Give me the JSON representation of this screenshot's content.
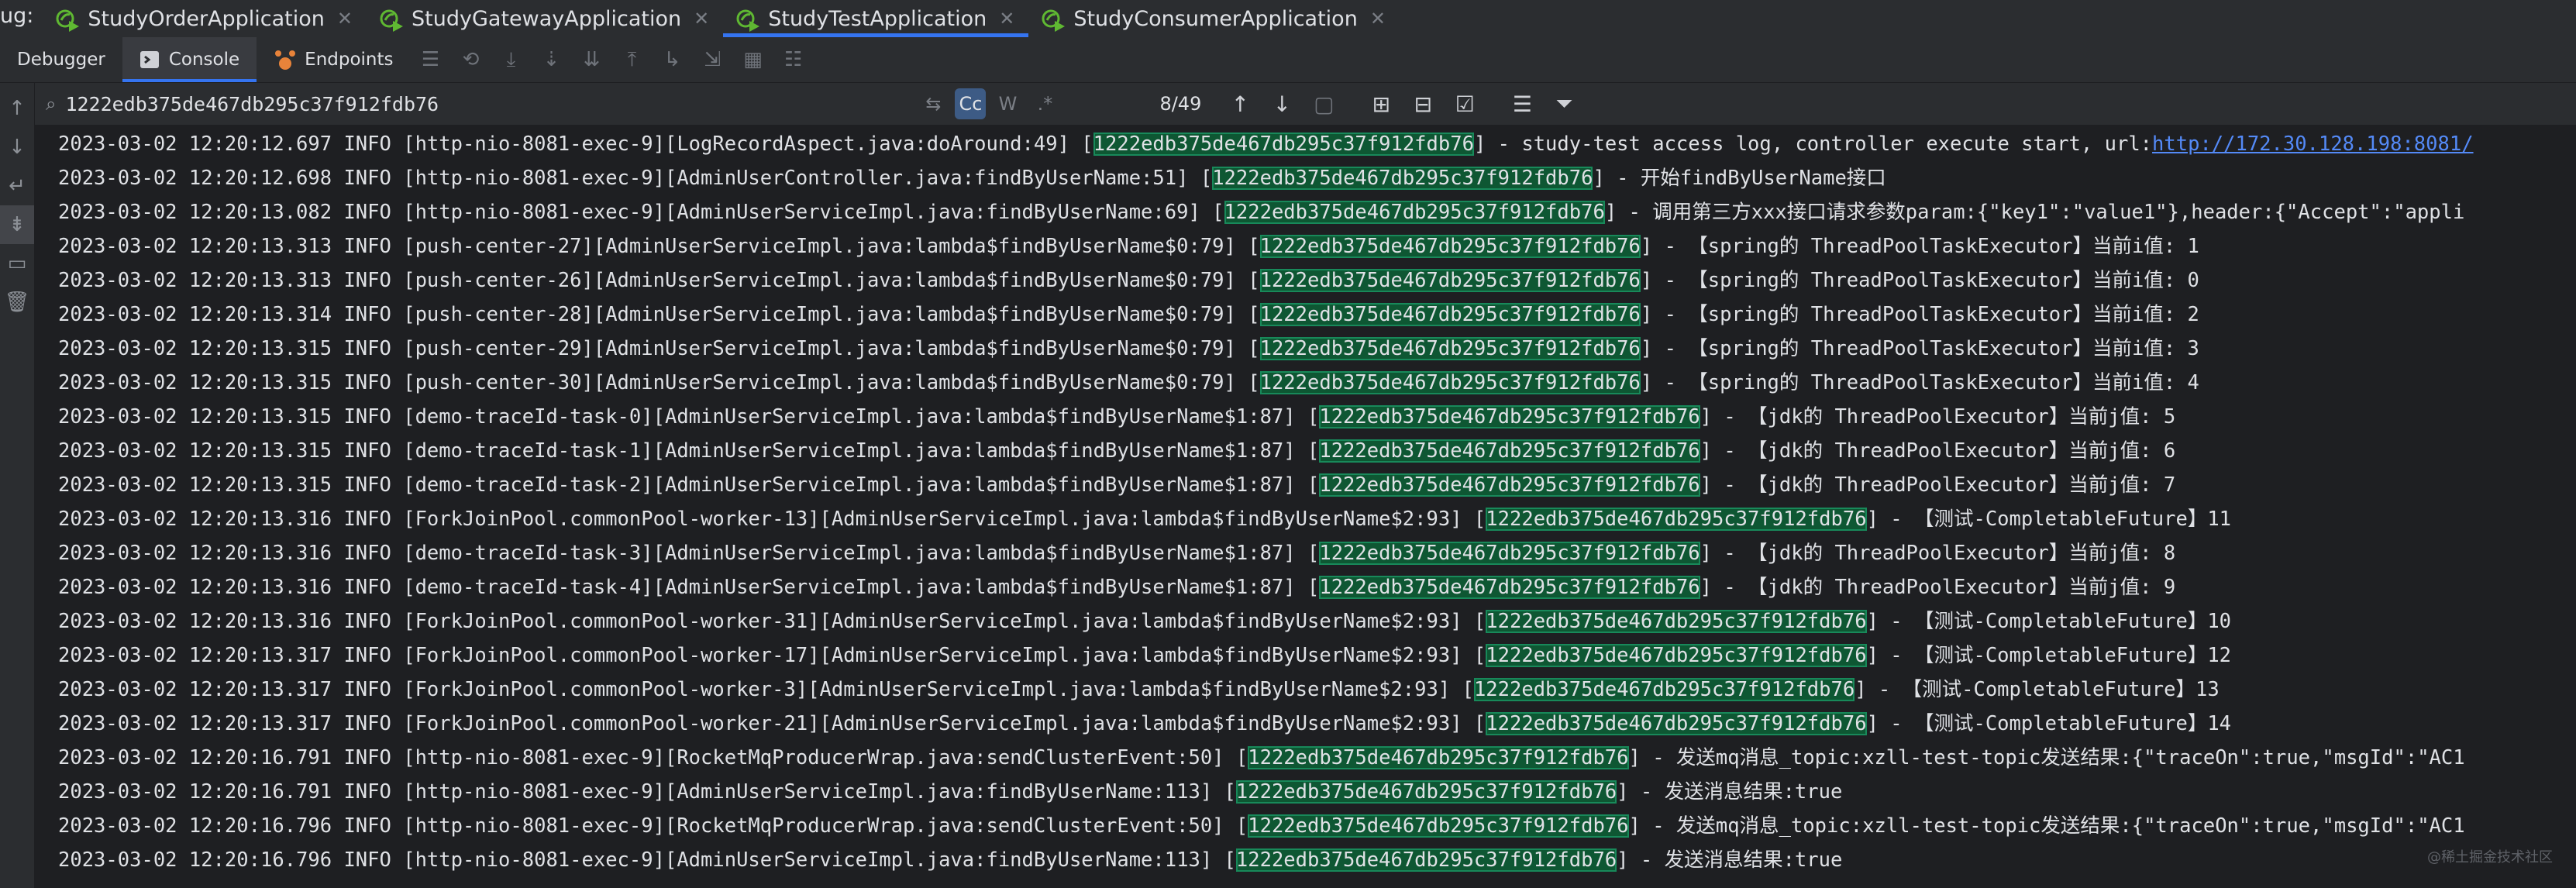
{
  "run_tabs": {
    "prefix": "ug:",
    "items": [
      {
        "label": "StudyOrderApplication",
        "active": false
      },
      {
        "label": "StudyGatewayApplication",
        "active": false
      },
      {
        "label": "StudyTestApplication",
        "active": true
      },
      {
        "label": "StudyConsumerApplication",
        "active": false
      }
    ]
  },
  "toolbar": {
    "debugger_label": "Debugger",
    "console_label": "Console",
    "endpoints_label": "Endpoints"
  },
  "find": {
    "query": "1222edb375de467db295c37f912fdb76",
    "case_label": "Cc",
    "words_label": "W",
    "regex_label": ".*",
    "match_count": "8/49"
  },
  "console_lines": [
    {
      "before": "2023-03-02 12:20:12.697 INFO [http-nio-8081-exec-9][LogRecordAspect.java:doAround:49] [",
      "trace": "1222edb375de467db295c37f912fdb76",
      "after": "] - study-test access log, controller execute start, url:",
      "link": "http://172.30.128.198:8081/"
    },
    {
      "before": "2023-03-02 12:20:12.698 INFO [http-nio-8081-exec-9][AdminUserController.java:findByUserName:51] [",
      "trace": "1222edb375de467db295c37f912fdb76",
      "after": "] - 开始findByUserName接口",
      "link": ""
    },
    {
      "before": "2023-03-02 12:20:13.082 INFO [http-nio-8081-exec-9][AdminUserServiceImpl.java:findByUserName:69] [",
      "trace": "1222edb375de467db295c37f912fdb76",
      "after": "] - 调用第三方xxx接口请求参数param:{\"key1\":\"value1\"},header:{\"Accept\":\"appli",
      "link": ""
    },
    {
      "before": "2023-03-02 12:20:13.313 INFO [push-center-27][AdminUserServiceImpl.java:lambda$findByUserName$0:79] [",
      "trace": "1222edb375de467db295c37f912fdb76",
      "after": "] - 【spring的 ThreadPoolTaskExecutor】当前i值: 1",
      "link": ""
    },
    {
      "before": "2023-03-02 12:20:13.313 INFO [push-center-26][AdminUserServiceImpl.java:lambda$findByUserName$0:79] [",
      "trace": "1222edb375de467db295c37f912fdb76",
      "after": "] - 【spring的 ThreadPoolTaskExecutor】当前i值: 0",
      "link": ""
    },
    {
      "before": "2023-03-02 12:20:13.314 INFO [push-center-28][AdminUserServiceImpl.java:lambda$findByUserName$0:79] [",
      "trace": "1222edb375de467db295c37f912fdb76",
      "after": "] - 【spring的 ThreadPoolTaskExecutor】当前i值: 2",
      "link": ""
    },
    {
      "before": "2023-03-02 12:20:13.315 INFO [push-center-29][AdminUserServiceImpl.java:lambda$findByUserName$0:79] [",
      "trace": "1222edb375de467db295c37f912fdb76",
      "after": "] - 【spring的 ThreadPoolTaskExecutor】当前i值: 3",
      "link": ""
    },
    {
      "before": "2023-03-02 12:20:13.315 INFO [push-center-30][AdminUserServiceImpl.java:lambda$findByUserName$0:79] [",
      "trace": "1222edb375de467db295c37f912fdb76",
      "after": "] - 【spring的 ThreadPoolTaskExecutor】当前i值: 4",
      "link": ""
    },
    {
      "before": "2023-03-02 12:20:13.315 INFO [demo-traceId-task-0][AdminUserServiceImpl.java:lambda$findByUserName$1:87] [",
      "trace": "1222edb375de467db295c37f912fdb76",
      "after": "] - 【jdk的 ThreadPoolExecutor】当前j值: 5",
      "link": ""
    },
    {
      "before": "2023-03-02 12:20:13.315 INFO [demo-traceId-task-1][AdminUserServiceImpl.java:lambda$findByUserName$1:87] [",
      "trace": "1222edb375de467db295c37f912fdb76",
      "after": "] - 【jdk的 ThreadPoolExecutor】当前j值: 6",
      "link": ""
    },
    {
      "before": "2023-03-02 12:20:13.315 INFO [demo-traceId-task-2][AdminUserServiceImpl.java:lambda$findByUserName$1:87] [",
      "trace": "1222edb375de467db295c37f912fdb76",
      "after": "] - 【jdk的 ThreadPoolExecutor】当前j值: 7",
      "link": ""
    },
    {
      "before": "2023-03-02 12:20:13.316 INFO [ForkJoinPool.commonPool-worker-13][AdminUserServiceImpl.java:lambda$findByUserName$2:93] [",
      "trace": "1222edb375de467db295c37f912fdb76",
      "after": "] - 【测试-CompletableFuture】11",
      "link": ""
    },
    {
      "before": "2023-03-02 12:20:13.316 INFO [demo-traceId-task-3][AdminUserServiceImpl.java:lambda$findByUserName$1:87] [",
      "trace": "1222edb375de467db295c37f912fdb76",
      "after": "] - 【jdk的 ThreadPoolExecutor】当前j值: 8",
      "link": ""
    },
    {
      "before": "2023-03-02 12:20:13.316 INFO [demo-traceId-task-4][AdminUserServiceImpl.java:lambda$findByUserName$1:87] [",
      "trace": "1222edb375de467db295c37f912fdb76",
      "after": "] - 【jdk的 ThreadPoolExecutor】当前j值: 9",
      "link": ""
    },
    {
      "before": "2023-03-02 12:20:13.316 INFO [ForkJoinPool.commonPool-worker-31][AdminUserServiceImpl.java:lambda$findByUserName$2:93] [",
      "trace": "1222edb375de467db295c37f912fdb76",
      "after": "] - 【测试-CompletableFuture】10",
      "link": ""
    },
    {
      "before": "2023-03-02 12:20:13.317 INFO [ForkJoinPool.commonPool-worker-17][AdminUserServiceImpl.java:lambda$findByUserName$2:93] [",
      "trace": "1222edb375de467db295c37f912fdb76",
      "after": "] - 【测试-CompletableFuture】12",
      "link": ""
    },
    {
      "before": "2023-03-02 12:20:13.317 INFO [ForkJoinPool.commonPool-worker-3][AdminUserServiceImpl.java:lambda$findByUserName$2:93] [",
      "trace": "1222edb375de467db295c37f912fdb76",
      "after": "] - 【测试-CompletableFuture】13",
      "link": ""
    },
    {
      "before": "2023-03-02 12:20:13.317 INFO [ForkJoinPool.commonPool-worker-21][AdminUserServiceImpl.java:lambda$findByUserName$2:93] [",
      "trace": "1222edb375de467db295c37f912fdb76",
      "after": "] - 【测试-CompletableFuture】14",
      "link": ""
    },
    {
      "before": "2023-03-02 12:20:16.791 INFO [http-nio-8081-exec-9][RocketMqProducerWrap.java:sendClusterEvent:50] [",
      "trace": "1222edb375de467db295c37f912fdb76",
      "after": "] - 发送mq消息_topic:xzll-test-topic发送结果:{\"traceOn\":true,\"msgId\":\"AC1",
      "link": ""
    },
    {
      "before": "2023-03-02 12:20:16.791 INFO [http-nio-8081-exec-9][AdminUserServiceImpl.java:findByUserName:113] [",
      "trace": "1222edb375de467db295c37f912fdb76",
      "after": "] - 发送消息结果:true",
      "link": ""
    },
    {
      "before": "2023-03-02 12:20:16.796 INFO [http-nio-8081-exec-9][RocketMqProducerWrap.java:sendClusterEvent:50] [",
      "trace": "1222edb375de467db295c37f912fdb76",
      "after": "] - 发送mq消息_topic:xzll-test-topic发送结果:{\"traceOn\":true,\"msgId\":\"AC1",
      "link": ""
    },
    {
      "before": "2023-03-02 12:20:16.796 INFO [http-nio-8081-exec-9][AdminUserServiceImpl.java:findByUserName:113] [",
      "trace": "1222edb375de467db295c37f912fdb76",
      "after": "] - 发送消息结果:true",
      "link": ""
    }
  ],
  "watermark": "@稀土掘金技术社区"
}
